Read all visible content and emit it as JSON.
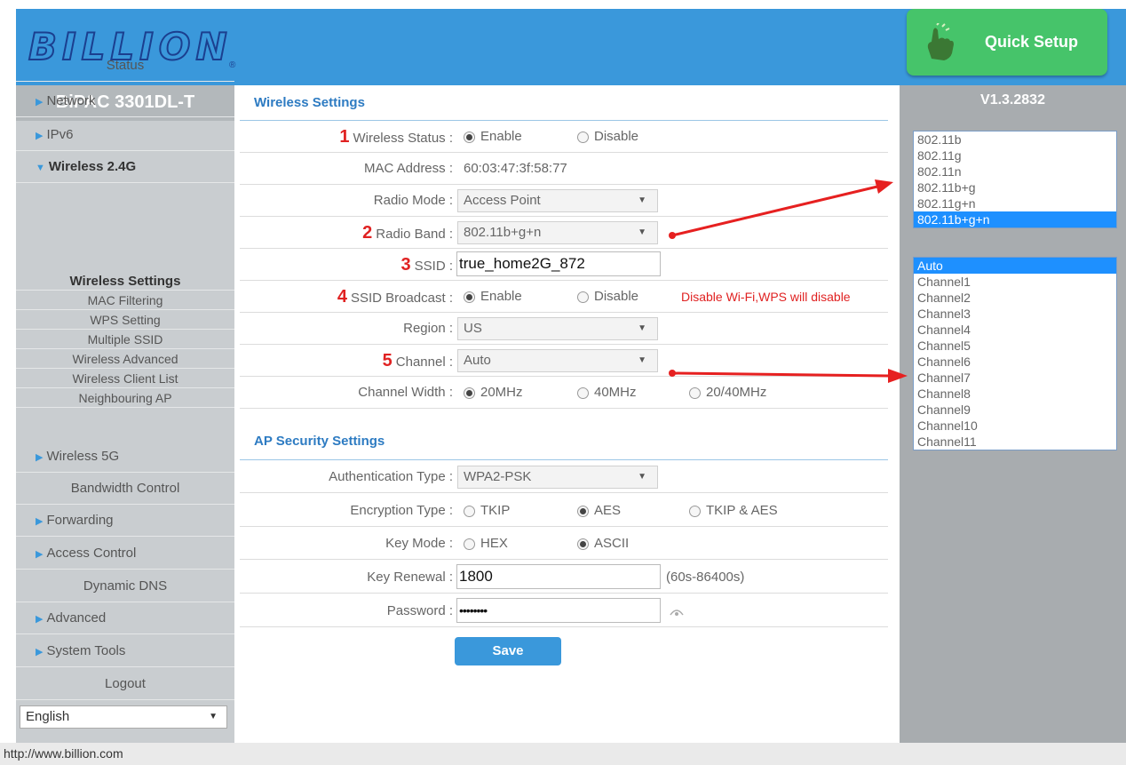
{
  "header": {
    "logo": "BILLION",
    "logo_mark": "®",
    "quick_setup": "Quick Setup"
  },
  "sidebar": {
    "model": "BiPAC 3301DL-T",
    "items": [
      {
        "label": "Status",
        "arrow": ""
      },
      {
        "label": "Network",
        "arrow": "▶"
      },
      {
        "label": "IPv6",
        "arrow": "▶"
      },
      {
        "label": "Wireless 2.4G",
        "arrow": "▼"
      }
    ],
    "subitems": [
      "Wireless Settings",
      "MAC Filtering",
      "WPS Setting",
      "Multiple SSID",
      "Wireless Advanced",
      "Wireless Client List",
      "Neighbouring AP"
    ],
    "items2": [
      {
        "label": "Wireless 5G",
        "arrow": "▶"
      },
      {
        "label": "Bandwidth Control",
        "arrow": ""
      },
      {
        "label": "Forwarding",
        "arrow": "▶"
      },
      {
        "label": "Access Control",
        "arrow": "▶"
      },
      {
        "label": "Dynamic DNS",
        "arrow": ""
      },
      {
        "label": "Advanced",
        "arrow": "▶"
      },
      {
        "label": "System Tools",
        "arrow": "▶"
      },
      {
        "label": "Logout",
        "arrow": ""
      }
    ],
    "language": "English"
  },
  "footer": {
    "url": "http://www.billion.com"
  },
  "wireless": {
    "title": "Wireless Settings",
    "status": {
      "num": "1",
      "label": "Wireless Status :",
      "opt1": "Enable",
      "opt2": "Disable"
    },
    "mac": {
      "label": "MAC Address :",
      "value": "60:03:47:3f:58:77"
    },
    "radio_mode": {
      "label": "Radio Mode :",
      "value": "Access Point"
    },
    "radio_band": {
      "num": "2",
      "label": "Radio Band :",
      "value": "802.11b+g+n"
    },
    "ssid": {
      "num": "3",
      "label": "SSID :",
      "value": "true_home2G_872"
    },
    "ssid_broadcast": {
      "num": "4",
      "label": "SSID Broadcast :",
      "opt1": "Enable",
      "opt2": "Disable",
      "note": "Disable Wi-Fi,WPS will disable"
    },
    "region": {
      "label": "Region :",
      "value": "US"
    },
    "channel": {
      "num": "5",
      "label": "Channel :",
      "value": "Auto"
    },
    "channel_width": {
      "label": "Channel Width :",
      "opt1": "20MHz",
      "opt2": "40MHz",
      "opt3": "20/40MHz"
    }
  },
  "security": {
    "title": "AP Security Settings",
    "auth": {
      "label": "Authentication Type :",
      "value": "WPA2-PSK"
    },
    "encryption": {
      "label": "Encryption Type :",
      "opt1": "TKIP",
      "opt2": "AES",
      "opt3": "TKIP & AES"
    },
    "key_mode": {
      "label": "Key Mode :",
      "opt1": "HEX",
      "opt2": "ASCII"
    },
    "key_renewal": {
      "label": "Key Renewal :",
      "value": "1800",
      "hint": "(60s-86400s)"
    },
    "password": {
      "label": "Password :",
      "value": "••••••••"
    },
    "save": "Save"
  },
  "right": {
    "version": "V1.3.2832",
    "bands": [
      "802.11b",
      "802.11g",
      "802.11n",
      "802.11b+g",
      "802.11g+n",
      "802.11b+g+n"
    ],
    "channels": [
      "Auto",
      "Channel1",
      "Channel2",
      "Channel3",
      "Channel4",
      "Channel5",
      "Channel6",
      "Channel7",
      "Channel8",
      "Channel9",
      "Channel10",
      "Channel11"
    ]
  },
  "colors": {
    "header": "#3a98db",
    "quick_setup": "#46c46a",
    "accent_red": "#e02222",
    "sidebar": "#c9cdd0",
    "right_panel": "#a8acaf"
  }
}
